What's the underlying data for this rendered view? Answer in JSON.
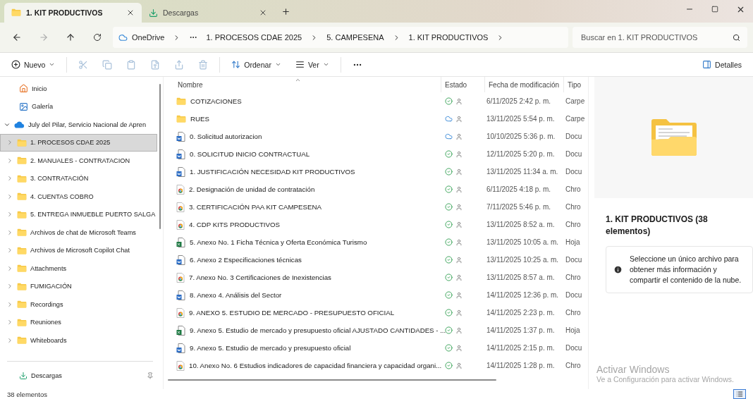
{
  "window": {
    "tabs": [
      {
        "label": "1. KIT PRODUCTIVOS",
        "kind": "folder",
        "selected": true
      },
      {
        "label": "Descargas",
        "kind": "download",
        "selected": false
      }
    ]
  },
  "address": {
    "root": "OneDrive",
    "crumbs": [
      "1. PROCESOS CDAE 2025",
      "5. CAMPESENA",
      "1. KIT PRODUCTIVOS"
    ]
  },
  "search": {
    "placeholder": "Buscar en 1. KIT PRODUCTIVOS"
  },
  "toolbar": {
    "new": "Nuevo",
    "sort": "Ordenar",
    "view": "Ver",
    "details": "Detalles"
  },
  "sidebar": {
    "items": [
      {
        "label": "Inicio",
        "kind": "home"
      },
      {
        "label": "Galería",
        "kind": "gallery"
      },
      {
        "label": "July del Pilar, Servicio Nacional de Apren",
        "kind": "cloud",
        "expanded": true,
        "children": [
          {
            "label": "1. PROCESOS CDAE 2025",
            "selected": true
          },
          {
            "label": "2. MANUALES - CONTRATACION",
            "selected": false
          },
          {
            "label": "3. CONTRATACIÓN",
            "selected": false
          },
          {
            "label": "4. CUENTAS COBRO",
            "selected": false
          },
          {
            "label": "5. ENTREGA INMUEBLE PUERTO SALGA",
            "selected": false
          },
          {
            "label": "Archivos de chat de Microsoft Teams",
            "selected": false
          },
          {
            "label": "Archivos de Microsoft Copilot Chat",
            "selected": false
          },
          {
            "label": "Attachments",
            "selected": false
          },
          {
            "label": "FUMIGACIÓN",
            "selected": false
          },
          {
            "label": "Recordings",
            "selected": false
          },
          {
            "label": "Reuniones",
            "selected": false
          },
          {
            "label": "Whiteboards",
            "selected": false
          }
        ]
      }
    ],
    "pinned": [
      {
        "label": "Descargas"
      }
    ]
  },
  "table": {
    "columns": [
      "Nombre",
      "Estado",
      "Fecha de modificación",
      "Tipo"
    ],
    "rows": [
      {
        "name": "COTIZACIONES",
        "kind": "folder",
        "status": {
          "kind": "synced"
        },
        "date": "6/11/2025 2:42 p. m.",
        "type": "Carpe"
      },
      {
        "name": "RUES",
        "kind": "folder",
        "status": {
          "kind": "cloud"
        },
        "date": "13/11/2025 5:54 p. m.",
        "type": "Carpe"
      },
      {
        "name": "0. Solicitud autorizacion",
        "kind": "word",
        "status": {
          "kind": "cloud"
        },
        "date": "10/10/2025 5:36 p. m.",
        "type": "Docu"
      },
      {
        "name": "0. SOLICITUD INICIO CONTRACTUAL",
        "kind": "word",
        "status": {
          "kind": "synced"
        },
        "date": "12/11/2025 5:20 p. m.",
        "type": "Docu"
      },
      {
        "name": "1. JUSTIFICACIÓN NECESIDAD KIT PRODUCTIVOS",
        "kind": "word",
        "status": {
          "kind": "synced"
        },
        "date": "13/11/2025 11:34 a. m.",
        "type": "Docu"
      },
      {
        "name": "2. Designación de unidad de contratación",
        "kind": "pdf",
        "status": {
          "kind": "synced"
        },
        "date": "6/11/2025 4:18 p. m.",
        "type": "Chro"
      },
      {
        "name": "3. CERTIFICACIÓN PAA KIT CAMPESENA",
        "kind": "pdf",
        "status": {
          "kind": "synced"
        },
        "date": "7/11/2025 5:46 p. m.",
        "type": "Chro"
      },
      {
        "name": "4. CDP KITS PRODUCTIVOS",
        "kind": "pdf",
        "status": {
          "kind": "synced"
        },
        "date": "13/11/2025 8:52 a. m.",
        "type": "Chro"
      },
      {
        "name": "5. Anexo No. 1 Ficha Técnica y Oferta Económica Turismo",
        "kind": "excel",
        "status": {
          "kind": "synced"
        },
        "date": "13/11/2025 10:05 a. m.",
        "type": "Hoja"
      },
      {
        "name": "6. Anexo 2 Especificaciones técnicas",
        "kind": "word",
        "status": {
          "kind": "synced"
        },
        "date": "13/11/2025 10:25 a. m.",
        "type": "Docu"
      },
      {
        "name": "7. Anexo No. 3 Certificaciones de Inexistencias",
        "kind": "pdf",
        "status": {
          "kind": "synced"
        },
        "date": "13/11/2025 8:57 a. m.",
        "type": "Chro"
      },
      {
        "name": "8. Anexo 4. Análisis del Sector",
        "kind": "word",
        "status": {
          "kind": "synced"
        },
        "date": "14/11/2025 12:36 p. m.",
        "type": "Docu"
      },
      {
        "name": "9. ANEXO 5. ESTUDIO DE MERCADO - PRESUPUESTO OFICIAL",
        "kind": "pdf",
        "status": {
          "kind": "synced"
        },
        "date": "14/11/2025 2:23 p. m.",
        "type": "Chro"
      },
      {
        "name": "9. Anexo 5. Estudio de mercado y presupuesto oficial  AJUSTADO CANTIDADES - ...",
        "kind": "excel",
        "status": {
          "kind": "synced"
        },
        "date": "14/11/2025 1:37 p. m.",
        "type": "Hoja"
      },
      {
        "name": "9. Anexo 5. Estudio de mercado y presupuesto oficial",
        "kind": "word",
        "status": {
          "kind": "synced"
        },
        "date": "14/11/2025 2:15 p. m.",
        "type": "Docu"
      },
      {
        "name": "10. Anexo No. 6 Estudios indicadores de capacidad financiera y capacidad organi...",
        "kind": "pdf",
        "status": {
          "kind": "synced"
        },
        "date": "14/11/2025 1:28 p. m.",
        "type": "Chro"
      }
    ]
  },
  "details": {
    "title": "1. KIT PRODUCTIVOS (38 elementos)",
    "info": "Seleccione un único archivo para obtener más información y compartir el contenido de la nube."
  },
  "activation": {
    "title": "Activar Windows",
    "subtitle": "Ve a Configuración para activar Windows."
  },
  "status_bar": {
    "count": "38 elementos"
  }
}
